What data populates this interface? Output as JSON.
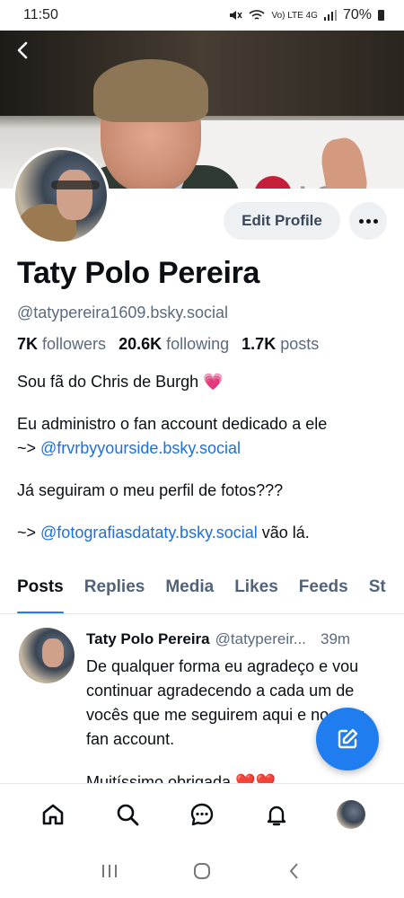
{
  "status_bar": {
    "time": "11:50",
    "network": "Vo) LTE 4G",
    "battery": "70%"
  },
  "profile": {
    "display_name": "Taty Polo Pereira",
    "handle": "@tatypereira1609.bsky.social",
    "followers_count": "7K",
    "followers_label": "followers",
    "following_count": "20.6K",
    "following_label": "following",
    "posts_count": "1.7K",
    "posts_label": "posts",
    "edit_label": "Edit Profile",
    "banner_sign_text": "LG"
  },
  "bio": {
    "line1": "Sou fã do Chris de Burgh",
    "line1_emoji": "💗",
    "line2": "Eu administro o fan account dedicado a ele",
    "line3_prefix": "~> ",
    "line3_link": "@frvrbyyourside.bsky.social",
    "line4": "Já seguiram o meu perfil de fotos???",
    "line5_prefix": "~> ",
    "line5_link": "@fotografiasdataty.bsky.social",
    "line5_suffix": " vão lá."
  },
  "tabs": [
    {
      "label": "Posts",
      "active": true
    },
    {
      "label": "Replies"
    },
    {
      "label": "Media"
    },
    {
      "label": "Likes"
    },
    {
      "label": "Feeds"
    },
    {
      "label": "St"
    }
  ],
  "post": {
    "author": "Taty Polo Pereira",
    "handle": "@tatypereir...",
    "time": "39m",
    "text": "De qualquer forma eu agradeço e vou continuar agradecendo a cada um de vocês que me seguirem aqui e no meu fan account.",
    "text2": "Muitíssimo obrigada ❤️❤️"
  },
  "colors": {
    "accent": "#1c7cf0",
    "link": "#1c6fe0",
    "muted": "#5b6a7c"
  },
  "icons": {
    "back": "back-arrow-icon",
    "more": "more-horizontal-icon",
    "compose": "compose-icon",
    "home": "home-icon",
    "search": "search-icon",
    "chat": "chat-icon",
    "notifications": "bell-icon"
  }
}
